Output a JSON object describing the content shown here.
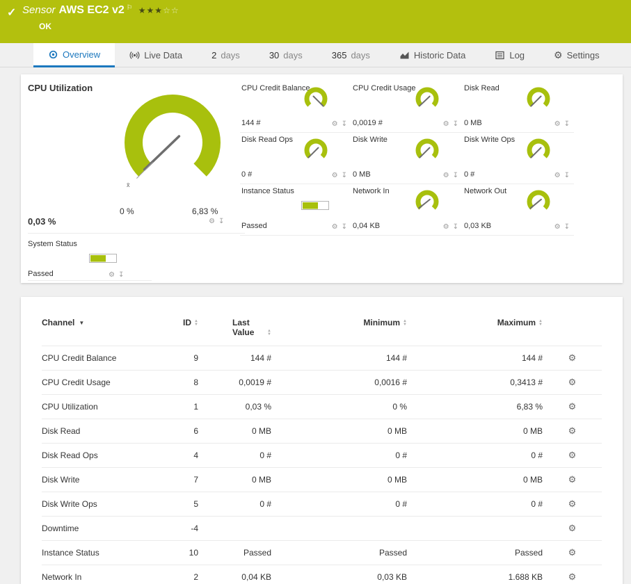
{
  "colors": {
    "header_bg": "#b3c00e",
    "gauge_green": "#a8c00d",
    "tab_active": "#1c78be"
  },
  "icons": {
    "check": "✓",
    "flag": "⚐",
    "gear": "⚙",
    "pin": "↧",
    "star_filled": "★",
    "star_empty": "☆",
    "sort_up": "▲",
    "sort_down": "▼",
    "channel_menu": "▼"
  },
  "header": {
    "kind": "Sensor",
    "title": "AWS EC2 v2",
    "status": "OK",
    "stars_filled": 3,
    "stars_total": 5
  },
  "tabs": [
    {
      "label": "Overview",
      "icon": "overview",
      "active": true
    },
    {
      "label": "Live Data",
      "icon": "live"
    },
    {
      "num": "2",
      "label": "days"
    },
    {
      "num": "30",
      "label": "days"
    },
    {
      "num": "365",
      "label": "days"
    },
    {
      "label": "Historic Data",
      "icon": "historic"
    },
    {
      "label": "Log",
      "icon": "log"
    },
    {
      "label": "Settings",
      "icon": "gear"
    }
  ],
  "main_gauge": {
    "title": "CPU Utilization",
    "value": "0,03 %",
    "min_label": "0 %",
    "max_label": "6,83 %",
    "fraction": 0.004,
    "mean_label": "x̄"
  },
  "small_gauges": [
    {
      "title": "CPU Credit Balance",
      "value": "144 #",
      "type": "gauge",
      "fraction": 1
    },
    {
      "title": "CPU Credit Usage",
      "value": "0,0019 #",
      "type": "gauge",
      "fraction": 0.006
    },
    {
      "title": "Disk Read",
      "value": "0 MB",
      "type": "gauge",
      "fraction": 0
    },
    {
      "title": "Disk Read Ops",
      "value": "0 #",
      "type": "gauge",
      "fraction": 0
    },
    {
      "title": "Disk Write",
      "value": "0 MB",
      "type": "gauge",
      "fraction": 0
    },
    {
      "title": "Disk Write Ops",
      "value": "0 #",
      "type": "gauge",
      "fraction": 0
    },
    {
      "title": "Instance Status",
      "value": "Passed",
      "type": "bar"
    },
    {
      "title": "Network In",
      "value": "0,04 KB",
      "type": "gauge",
      "fraction": 0.024
    },
    {
      "title": "Network Out",
      "value": "0,03 KB",
      "type": "gauge",
      "fraction": 0.02
    }
  ],
  "system_status": {
    "title": "System Status",
    "value": "Passed",
    "type": "bar"
  },
  "table": {
    "columns": [
      {
        "label": "Channel",
        "sort": "menu"
      },
      {
        "label": "ID",
        "sort": "carets"
      },
      {
        "label": "Last Value",
        "sort": "carets"
      },
      {
        "label": "Minimum",
        "sort": "carets"
      },
      {
        "label": "Maximum",
        "sort": "carets"
      },
      {
        "label": "",
        "sort": "none"
      }
    ],
    "rows": [
      [
        "CPU Credit Balance",
        "9",
        "144 #",
        "144 #",
        "144 #"
      ],
      [
        "CPU Credit Usage",
        "8",
        "0,0019 #",
        "0,0016 #",
        "0,3413 #"
      ],
      [
        "CPU Utilization",
        "1",
        "0,03 %",
        "0 %",
        "6,83 %"
      ],
      [
        "Disk Read",
        "6",
        "0 MB",
        "0 MB",
        "0 MB"
      ],
      [
        "Disk Read Ops",
        "4",
        "0 #",
        "0 #",
        "0 #"
      ],
      [
        "Disk Write",
        "7",
        "0 MB",
        "0 MB",
        "0 MB"
      ],
      [
        "Disk Write Ops",
        "5",
        "0 #",
        "0 #",
        "0 #"
      ],
      [
        "Downtime",
        "-4",
        "",
        "",
        ""
      ],
      [
        "Instance Status",
        "10",
        "Passed",
        "Passed",
        "Passed"
      ],
      [
        "Network In",
        "2",
        "0,04 KB",
        "0,03 KB",
        "1.688 KB"
      ]
    ]
  }
}
